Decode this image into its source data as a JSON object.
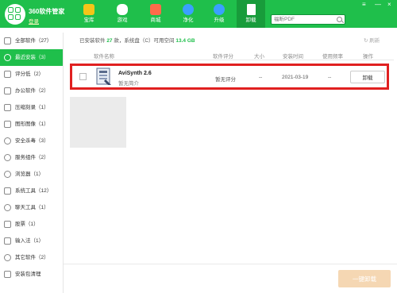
{
  "app": {
    "title": "360软件管家",
    "login": "登录"
  },
  "nav": [
    {
      "label": "宝库",
      "color": "#f5c518"
    },
    {
      "label": "游戏",
      "color": "#ffffff"
    },
    {
      "label": "商城",
      "color": "#ff6b4a"
    },
    {
      "label": "净化",
      "color": "#3aa0ff"
    },
    {
      "label": "升级",
      "color": "#3aa0ff"
    },
    {
      "label": "卸载",
      "color": "#ffffff"
    }
  ],
  "window": {
    "menu": "≡",
    "minimize": "—",
    "close": "×"
  },
  "search": {
    "placeholder": "福昕PDF"
  },
  "sidebar": {
    "items": [
      {
        "label": "全部软件（27）"
      },
      {
        "label": "最近安装（3）"
      },
      {
        "label": "评分低（2）"
      },
      {
        "label": "办公软件（2）"
      },
      {
        "label": "压缩刻录（1）"
      },
      {
        "label": "图形图像（1）"
      },
      {
        "label": "安全杀毒（3）"
      },
      {
        "label": "服务组件（2）"
      },
      {
        "label": "浏览器（1）"
      },
      {
        "label": "系统工具（12）"
      },
      {
        "label": "聊天工具（1）"
      },
      {
        "label": "股票（1）"
      },
      {
        "label": "输入法（1）"
      },
      {
        "label": "其它软件（2）"
      },
      {
        "label": "安装包清理"
      }
    ]
  },
  "summary": {
    "prefix": "已安装软件",
    "count": "27",
    "middle": "款，系统盘（C）可用空间",
    "space": "13.4 GB"
  },
  "refresh_label": "刷新",
  "table": {
    "headers": {
      "name": "软件名称",
      "rating": "软件评分",
      "size": "大小",
      "install_time": "安装时间",
      "frequency": "使用频率",
      "action": "操作"
    },
    "rows": [
      {
        "name": "AviSynth 2.6",
        "desc": "暂无简介",
        "rating": "暂无评分",
        "size": "--",
        "install_time": "2021-03-19",
        "frequency": "--",
        "action": "卸载"
      }
    ]
  },
  "one_key_uninstall": "一键卸载"
}
